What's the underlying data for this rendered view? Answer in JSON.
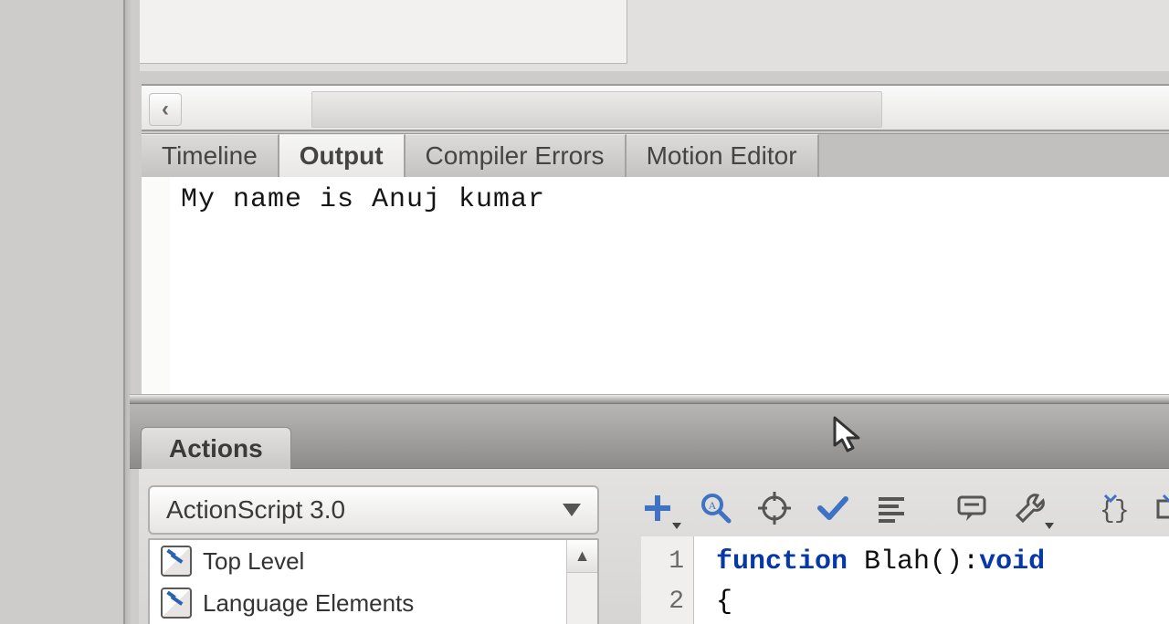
{
  "tabs": {
    "timeline": "Timeline",
    "output": "Output",
    "compiler_errors": "Compiler Errors",
    "motion_editor": "Motion Editor"
  },
  "output_text": "My name is Anuj kumar",
  "actions": {
    "title": "Actions",
    "lang_select": "ActionScript 3.0",
    "tree": [
      "Top Level",
      "Language Elements"
    ]
  },
  "code": {
    "line1": {
      "kw": "function",
      "name": " Blah()",
      "colon": ":",
      "ty": "void"
    },
    "line2": "{",
    "gutter": [
      "1",
      "2"
    ]
  }
}
